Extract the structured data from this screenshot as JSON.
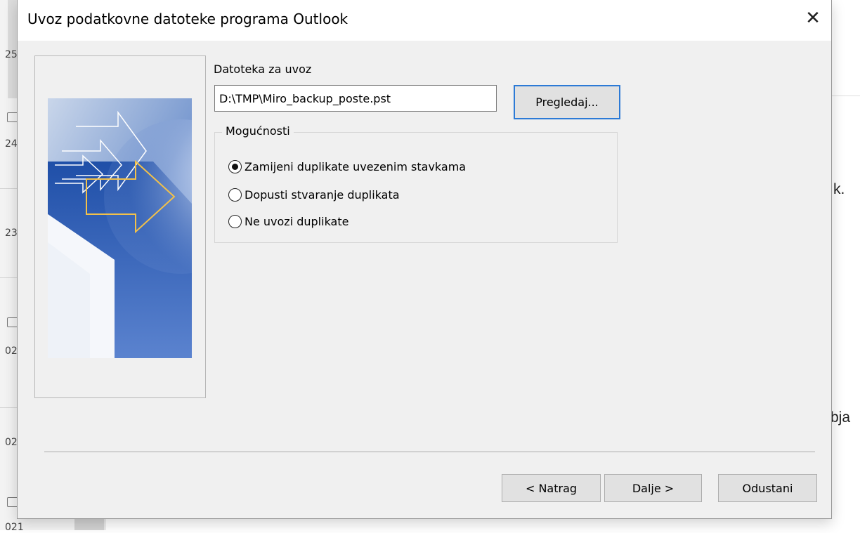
{
  "dialog": {
    "title": "Uvoz podatkovne datoteke programa Outlook",
    "close_icon": "close-icon",
    "file_label": "Datoteka za uvoz",
    "file_value": "D:\\TMP\\Miro_backup_poste.pst",
    "browse_label": "Pregledaj...",
    "options_legend": "Mogućnosti",
    "options": [
      {
        "label": "Zamijeni duplikate uvezenim stavkama",
        "selected": true
      },
      {
        "label": "Dopusti stvaranje duplikata",
        "selected": false
      },
      {
        "label": "Ne uvozi duplikate",
        "selected": false
      }
    ],
    "back_label": "< Natrag",
    "next_label": "Dalje >",
    "cancel_label": "Odustani",
    "focus_color": "#2c7ad6"
  },
  "background": {
    "left_numbers": [
      "25",
      "24",
      "23",
      "02",
      "02",
      "021"
    ],
    "right_fragments": [
      "k.",
      "bja"
    ]
  }
}
